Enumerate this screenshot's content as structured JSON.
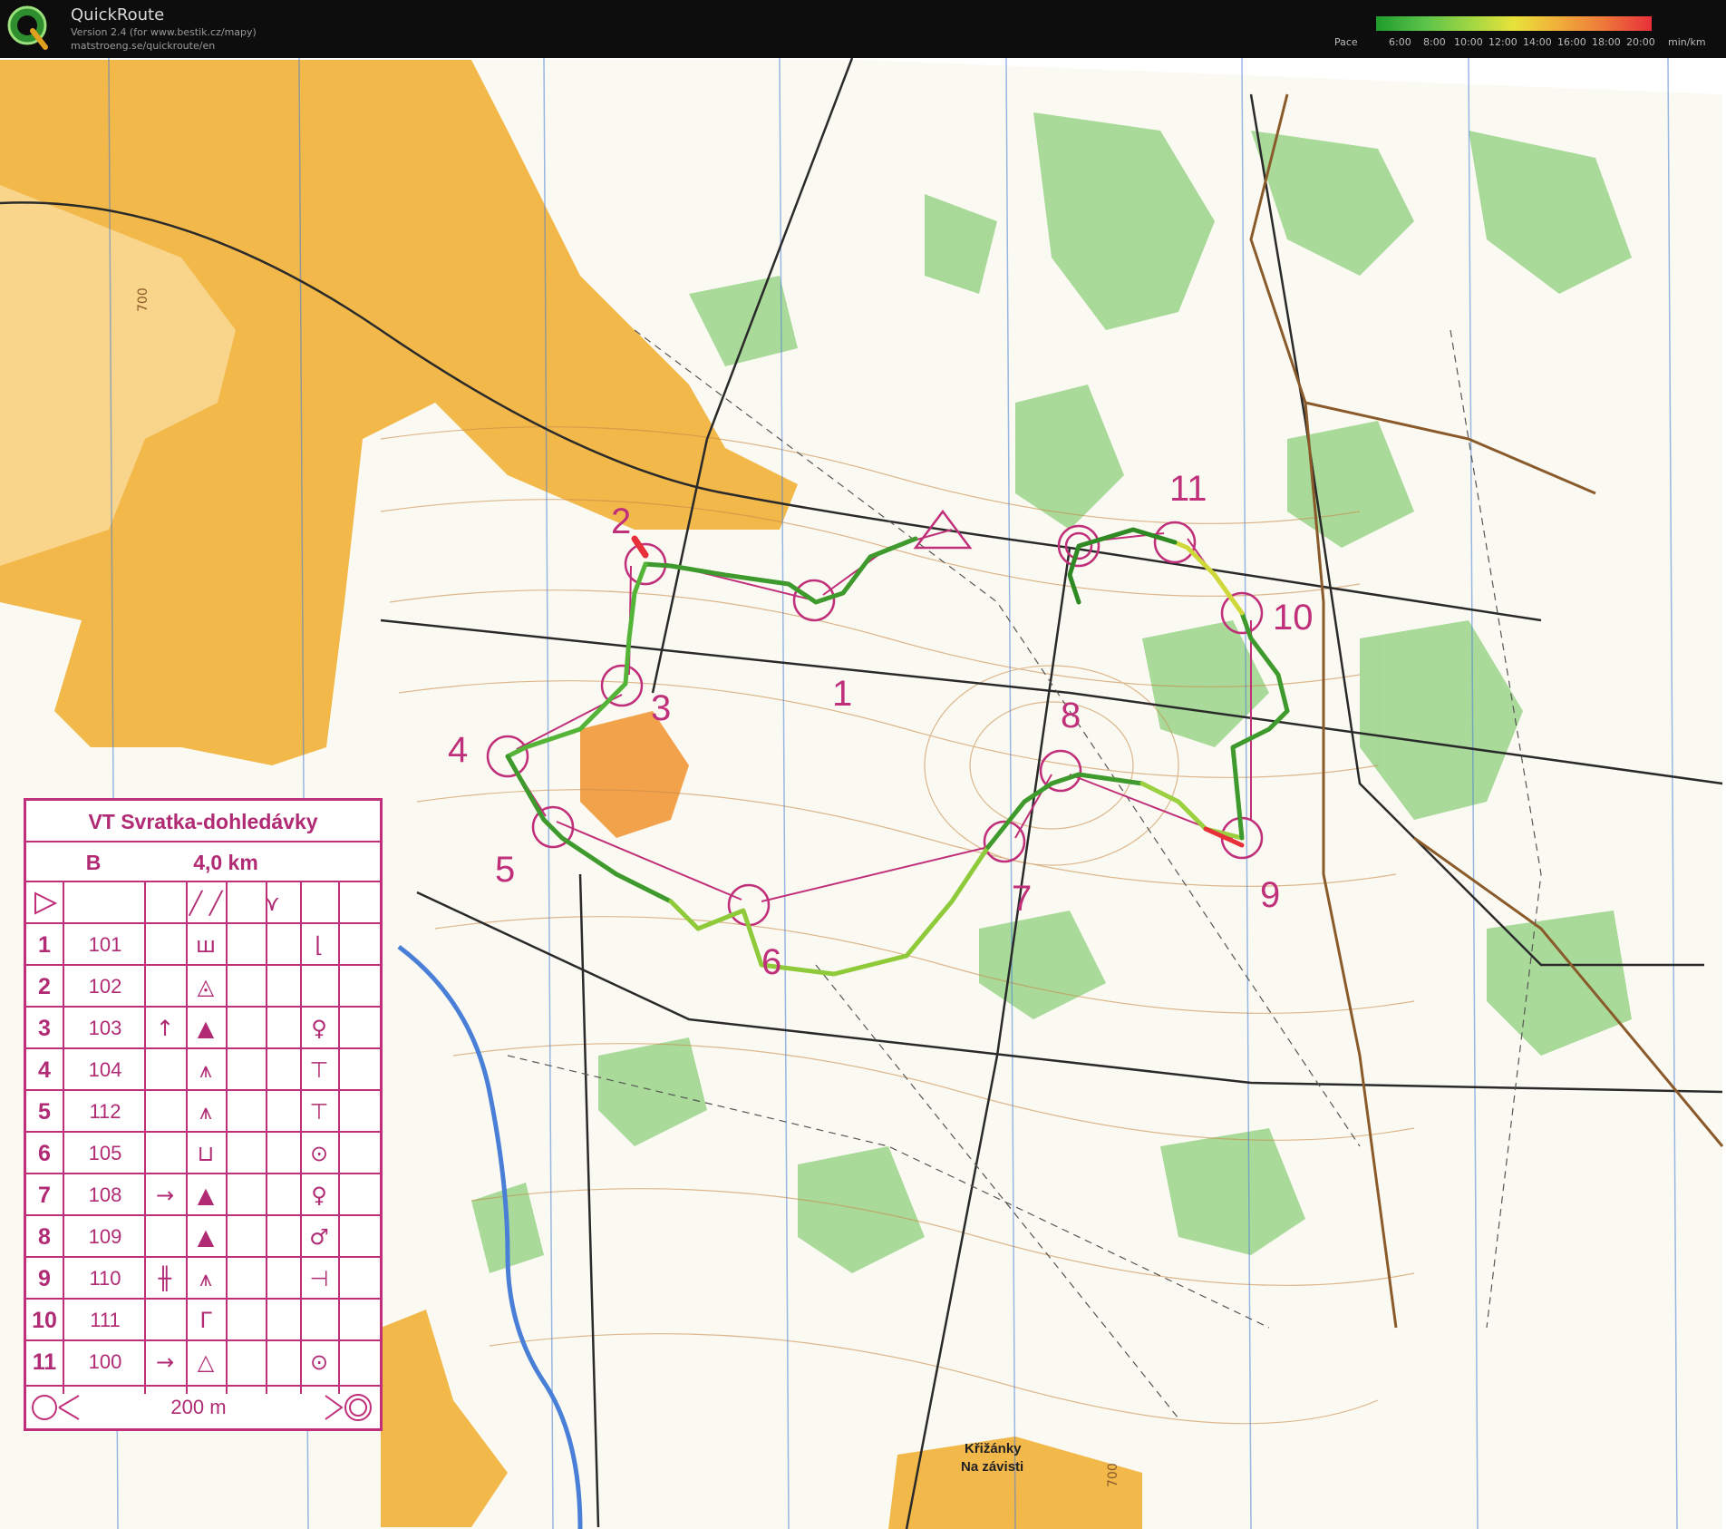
{
  "app": {
    "title": "QuickRoute",
    "version_line": "Version 2.4  (for www.bestik.cz/mapy)",
    "url_line": "matstroeng.se/quickroute/en"
  },
  "pace_legend": {
    "label": "Pace",
    "ticks": [
      "6:00",
      "8:00",
      "10:00",
      "12:00",
      "14:00",
      "16:00",
      "18:00",
      "20:00"
    ],
    "unit": "min/km"
  },
  "control_numbers": [
    "1",
    "2",
    "3",
    "4",
    "5",
    "6",
    "7",
    "8",
    "9",
    "10",
    "11"
  ],
  "contour_labels": [
    "700",
    "700"
  ],
  "place_names": [
    "Křižánky",
    "Na závisti"
  ],
  "description_sheet": {
    "title": "VT Svratka-dohledávky",
    "course": "B",
    "length": "4,0 km",
    "rows": [
      {
        "num": "1",
        "code": "101",
        "dir": "",
        "feature": "ш",
        "detail": "",
        "appearance": "",
        "location": "⌊"
      },
      {
        "num": "2",
        "code": "102",
        "dir": "",
        "feature": "◬",
        "detail": "",
        "appearance": "",
        "location": ""
      },
      {
        "num": "3",
        "code": "103",
        "dir": "↑",
        "feature": "▲",
        "detail": "",
        "appearance": "",
        "location": "♀"
      },
      {
        "num": "4",
        "code": "104",
        "dir": "",
        "feature": "⩚",
        "detail": "",
        "appearance": "",
        "location": "⊤"
      },
      {
        "num": "5",
        "code": "112",
        "dir": "",
        "feature": "⩚",
        "detail": "",
        "appearance": "",
        "location": "⊤"
      },
      {
        "num": "6",
        "code": "105",
        "dir": "",
        "feature": "⊔",
        "detail": "",
        "appearance": "",
        "location": "⊙"
      },
      {
        "num": "7",
        "code": "108",
        "dir": "→",
        "feature": "▲",
        "detail": "",
        "appearance": "",
        "location": "♀"
      },
      {
        "num": "8",
        "code": "109",
        "dir": "",
        "feature": "▲",
        "detail": "",
        "appearance": "",
        "location": "♂"
      },
      {
        "num": "9",
        "code": "110",
        "dir": "╫",
        "feature": "⩚",
        "detail": "",
        "appearance": "",
        "location": "⊣"
      },
      {
        "num": "10",
        "code": "111",
        "dir": "",
        "feature": "Γ",
        "detail": "",
        "appearance": "",
        "location": ""
      },
      {
        "num": "11",
        "code": "100",
        "dir": "→",
        "feature": "△",
        "detail": "",
        "appearance": "",
        "location": "⊙"
      }
    ],
    "finish_distance": "200 m"
  },
  "colors": {
    "course": "#c0307a",
    "open_land": "#f2b84a",
    "forest_green": "#8ccf7e",
    "water": "#4a7fd8",
    "road": "#2a2a2a"
  }
}
